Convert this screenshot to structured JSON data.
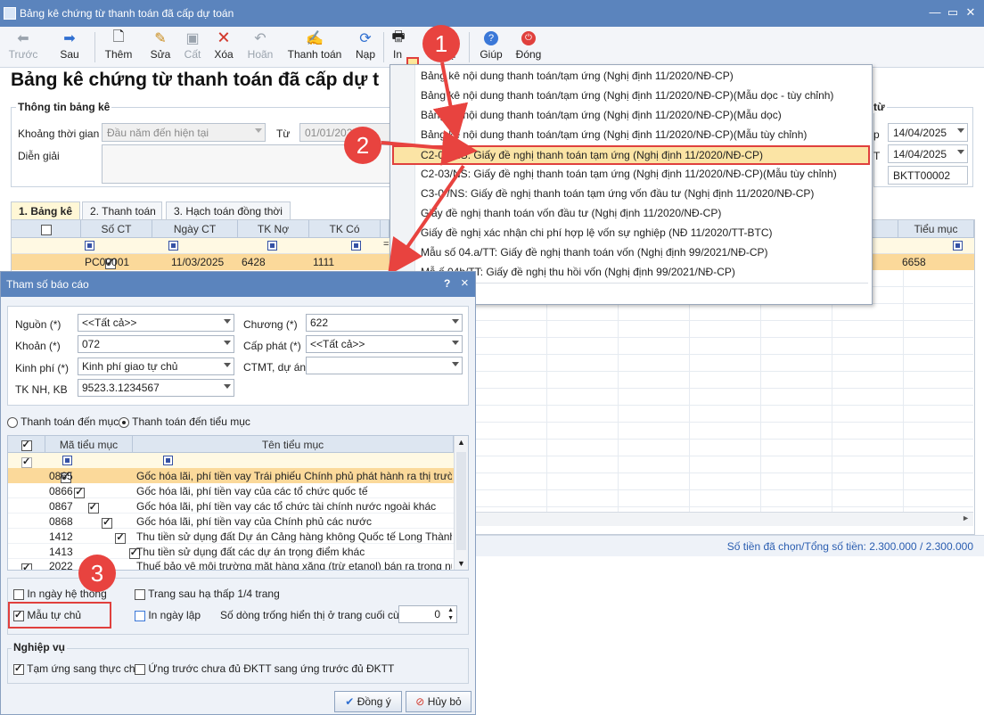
{
  "window": {
    "title": "Bảng kê chứng từ thanh toán đã cấp dự toán"
  },
  "toolbar": {
    "truoc": "Trước",
    "sau": "Sau",
    "them": "Thêm",
    "sua": "Sửa",
    "cat": "Cất",
    "xoa": "Xóa",
    "hoan": "Hoãn",
    "thanh_toan": "Thanh toán",
    "nap": "Nạp",
    "in": "In",
    "phu": "ụ",
    "giup": "Giúp",
    "dong": "Đóng"
  },
  "page": {
    "heading": "Bảng kê chứng từ thanh toán đã cấp dự t"
  },
  "info": {
    "group_title": "Thông tin bảng kê",
    "khoang_label": "Khoảng thời gian",
    "khoang_value": "Đầu năm đến hiện tại",
    "tu_label": "Từ",
    "tu_value": "01/01/2025",
    "dien_giai_label": "Diễn giải",
    "right_group_title": "từ",
    "right_label1": "p",
    "right_label2": "T",
    "date1": "14/04/2025",
    "date2": "14/04/2025",
    "number": "BKTT00002"
  },
  "tabs": [
    "1. Bảng kê",
    "2. Thanh toán",
    "3. Hạch toán đồng thời"
  ],
  "grid": {
    "headers": [
      "Số CT",
      "Ngày CT",
      "TK Nợ",
      "TK Có"
    ],
    "header_right": "Tiểu mục",
    "filter_eq": "=",
    "row": {
      "so_ct": "PC00001",
      "ngay_ct": "11/03/2025",
      "tk_no": "6428",
      "tk_co": "1111",
      "tieu_muc": "6658"
    }
  },
  "menu": {
    "items": [
      "Bảng kê nội dung thanh toán/tạm ứng (Nghị định 11/2020/NĐ-CP)",
      "Bảng kê nội dung thanh toán/tạm ứng (Nghị định 11/2020/NĐ-CP)(Mẫu dọc - tùy chỉnh)",
      "Bảng kê nội dung thanh toán/tạm ứng (Nghị định 11/2020/NĐ-CP)(Mẫu dọc)",
      "Bảng kê nội dung thanh toán/tạm ứng (Nghị định 11/2020/NĐ-CP)(Mẫu tùy chỉnh)",
      "C2-03/NS: Giấy đề nghị thanh toán tạm ứng (Nghị định 11/2020/NĐ-CP)",
      "C2-03/NS: Giấy đề nghị thanh toán tạm ứng (Nghị định 11/2020/NĐ-CP)(Mẫu tùy chỉnh)",
      "C3-0 /NS: Giấy đề nghị thanh toán tạm ứng vốn đầu tư (Nghị định 11/2020/NĐ-CP)",
      "Giấy đề nghị thanh toán vốn đầu tư (Nghị định 11/2020/NĐ-CP)",
      "Giấy đề nghị xác nhận chi phí hợp lệ vốn sự nghiệp (NĐ 11/2020/TT-BTC)",
      "Mẫu số 04.a/TT: Giấy đề nghị thanh toán vốn (Nghị định 99/2021/NĐ-CP)",
      "Mẫ     ố 04b/TT: Giấy đề nghị thu hồi vốn (Nghị định 99/2021/NĐ-CP)",
      "..."
    ]
  },
  "callouts": [
    "1",
    "2",
    "3"
  ],
  "dialog": {
    "title": "Tham số báo cáo",
    "help": "?",
    "close": "×",
    "nguon_label": "Nguồn (*)",
    "nguon_value": "<<Tất cả>>",
    "khoan_label": "Khoản (*)",
    "khoan_value": "072",
    "kinhphi_label": "Kinh phí (*)",
    "kinhphi_value": "Kinh phí giao tự chủ",
    "tknh_label": "TK NH, KB",
    "tknh_value": "9523.3.1234567",
    "chuong_label": "Chương (*)",
    "chuong_value": "622",
    "capphat_label": "Cấp phát (*)",
    "capphat_value": "<<Tất cả>>",
    "ctmt_label": "CTMT, dự án",
    "ctmt_value": "",
    "radio1": "Thanh toán đến mục",
    "radio2": "Thanh toán đến tiểu mục",
    "table_headers": [
      "Mã tiểu mục",
      "Tên tiểu mục"
    ],
    "rows": [
      {
        "ma": "0865",
        "ten": "Gốc hóa lãi, phí tiền vay Trái phiếu Chính phủ phát hành ra thị trường..."
      },
      {
        "ma": "0866",
        "ten": "Gốc hóa lãi, phí tiền vay của các tổ chức quốc tế"
      },
      {
        "ma": "0867",
        "ten": "Gốc hóa lãi, phí tiền vay các tổ chức tài chính nước ngoài khác"
      },
      {
        "ma": "0868",
        "ten": "Gốc hóa lãi, phí tiền vay của Chính phủ các nước"
      },
      {
        "ma": "1412",
        "ten": "Thu tiền sử dụng đất Dự án Cảng hàng không Quốc tế Long Thành, tỉ..."
      },
      {
        "ma": "1413",
        "ten": "Thu tiền sử dụng đất các dự án trọng điểm khác"
      },
      {
        "ma": "2022",
        "ten": "Thuế bảo vệ môi trường mặt hàng xăng (trừ etanol) bán ra trong nước"
      }
    ],
    "opt_in_ngay_he_thong": "In ngày hệ thống",
    "opt_mau_tu_chu": "Mẫu tự chủ",
    "opt_trang_sau": "Trang sau hạ thấp 1/4 trang",
    "opt_in_ngay_lap": "In ngày lập",
    "opt_so_dong": "Số dòng trống hiển thị ở trang cuối cùng",
    "so_dong_value": "0",
    "nghiep_vu_title": "Nghiệp vụ",
    "nv1": "Tạm ứng sang thực chi",
    "nv2": "Ứng trước chưa đủ ĐKTT sang ứng trước đủ ĐKTT",
    "ok": "Đồng ý",
    "cancel": "Hủy bỏ"
  },
  "status": {
    "text": "Số tiền đã chọn/Tổng số tiền: 2.300.000 / 2.300.000"
  }
}
